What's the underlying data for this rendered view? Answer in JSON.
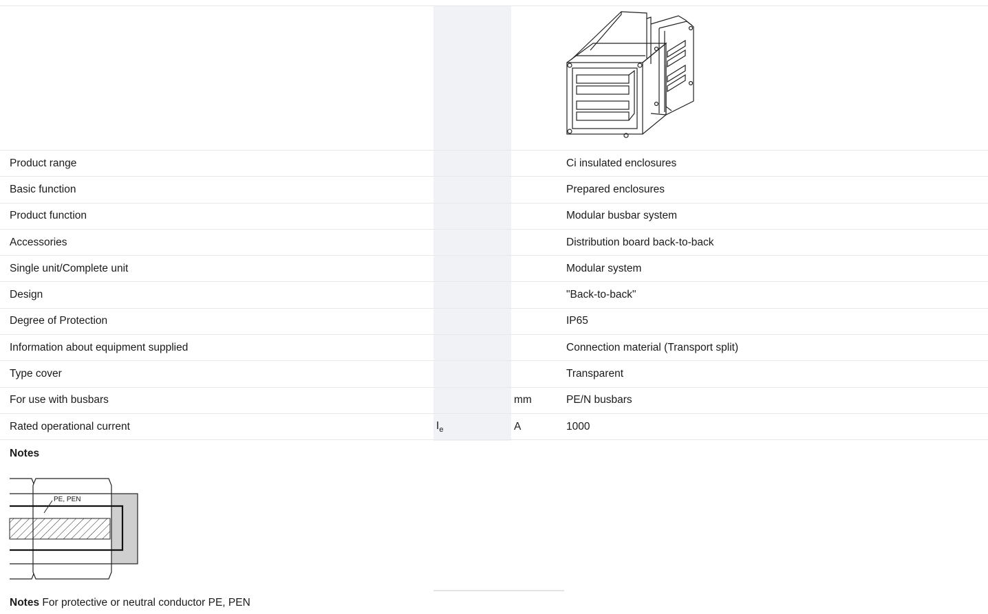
{
  "rows": [
    {
      "label": "Product range",
      "symbol": "",
      "unit": "",
      "value": "Ci insulated enclosures"
    },
    {
      "label": "Basic function",
      "symbol": "",
      "unit": "",
      "value": "Prepared enclosures"
    },
    {
      "label": "Product function",
      "symbol": "",
      "unit": "",
      "value": "Modular busbar system"
    },
    {
      "label": "Accessories",
      "symbol": "",
      "unit": "",
      "value": "Distribution board back-to-back"
    },
    {
      "label": "Single unit/Complete unit",
      "symbol": "",
      "unit": "",
      "value": "Modular system"
    },
    {
      "label": "Design",
      "symbol": "",
      "unit": "",
      "value": "\"Back-to-back\""
    },
    {
      "label": "Degree of Protection",
      "symbol": "",
      "unit": "",
      "value": "IP65"
    },
    {
      "label": "Information about equipment supplied",
      "symbol": "",
      "unit": "",
      "value": "Connection material (Transport split)"
    },
    {
      "label": "Type cover",
      "symbol": "",
      "unit": "",
      "value": "Transparent"
    },
    {
      "label": "For use with busbars",
      "symbol": "",
      "unit": "mm",
      "value": "PE/N busbars"
    },
    {
      "label": "Rated operational current",
      "symbol": "I",
      "symbol_sub": "e",
      "unit": "A",
      "value": "1000"
    }
  ],
  "notes": {
    "heading": "Notes",
    "figure_label": "PE, PEN",
    "footer_bold": "Notes",
    "footer_text": "For protective or neutral conductor PE, PEN"
  },
  "colors": {
    "column_shade": "#f1f2f5",
    "heading_blue": "#1e6fcf"
  }
}
